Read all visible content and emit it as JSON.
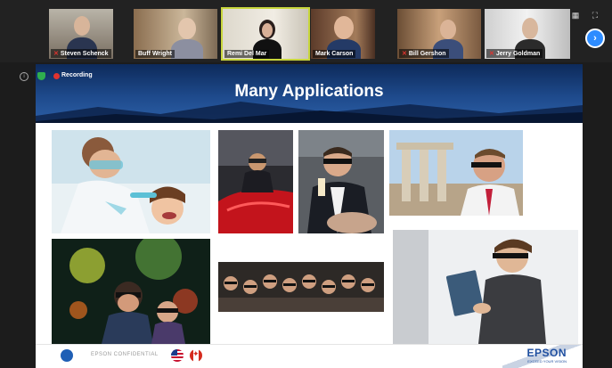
{
  "participants": [
    {
      "name": "Steven Schenck",
      "muted": true
    },
    {
      "name": "Buff Wright",
      "muted": false
    },
    {
      "name": "Remi Del Mar",
      "muted": false
    },
    {
      "name": "Mark Carson",
      "muted": false
    },
    {
      "name": "Bill Gershon",
      "muted": true
    },
    {
      "name": "Jerry Goldman",
      "muted": true
    }
  ],
  "meeting": {
    "recording_label": "Recording",
    "mute_glyph": "✕",
    "next_glyph": "›",
    "view_icons": "▦ ⛶",
    "info_glyph": "i"
  },
  "slide": {
    "title": "Many Applications",
    "footer": {
      "confidential": "EPSON CONFIDENTIAL",
      "brand": "EPSON",
      "tagline": "EXCEED YOUR VISION"
    }
  },
  "photos": [
    {
      "icon": "dentist-photo"
    },
    {
      "icon": "car-design-photo"
    },
    {
      "icon": "technician-photo"
    },
    {
      "icon": "tourism-photo"
    },
    {
      "icon": "theater-photo"
    },
    {
      "icon": "audience-photo"
    },
    {
      "icon": "reader-photo"
    }
  ],
  "colors": {
    "active_speaker": "#c8d63c",
    "recording_red": "#e0332f",
    "zoom_blue": "#2d8cff",
    "epson_blue": "#1f4fa0"
  }
}
